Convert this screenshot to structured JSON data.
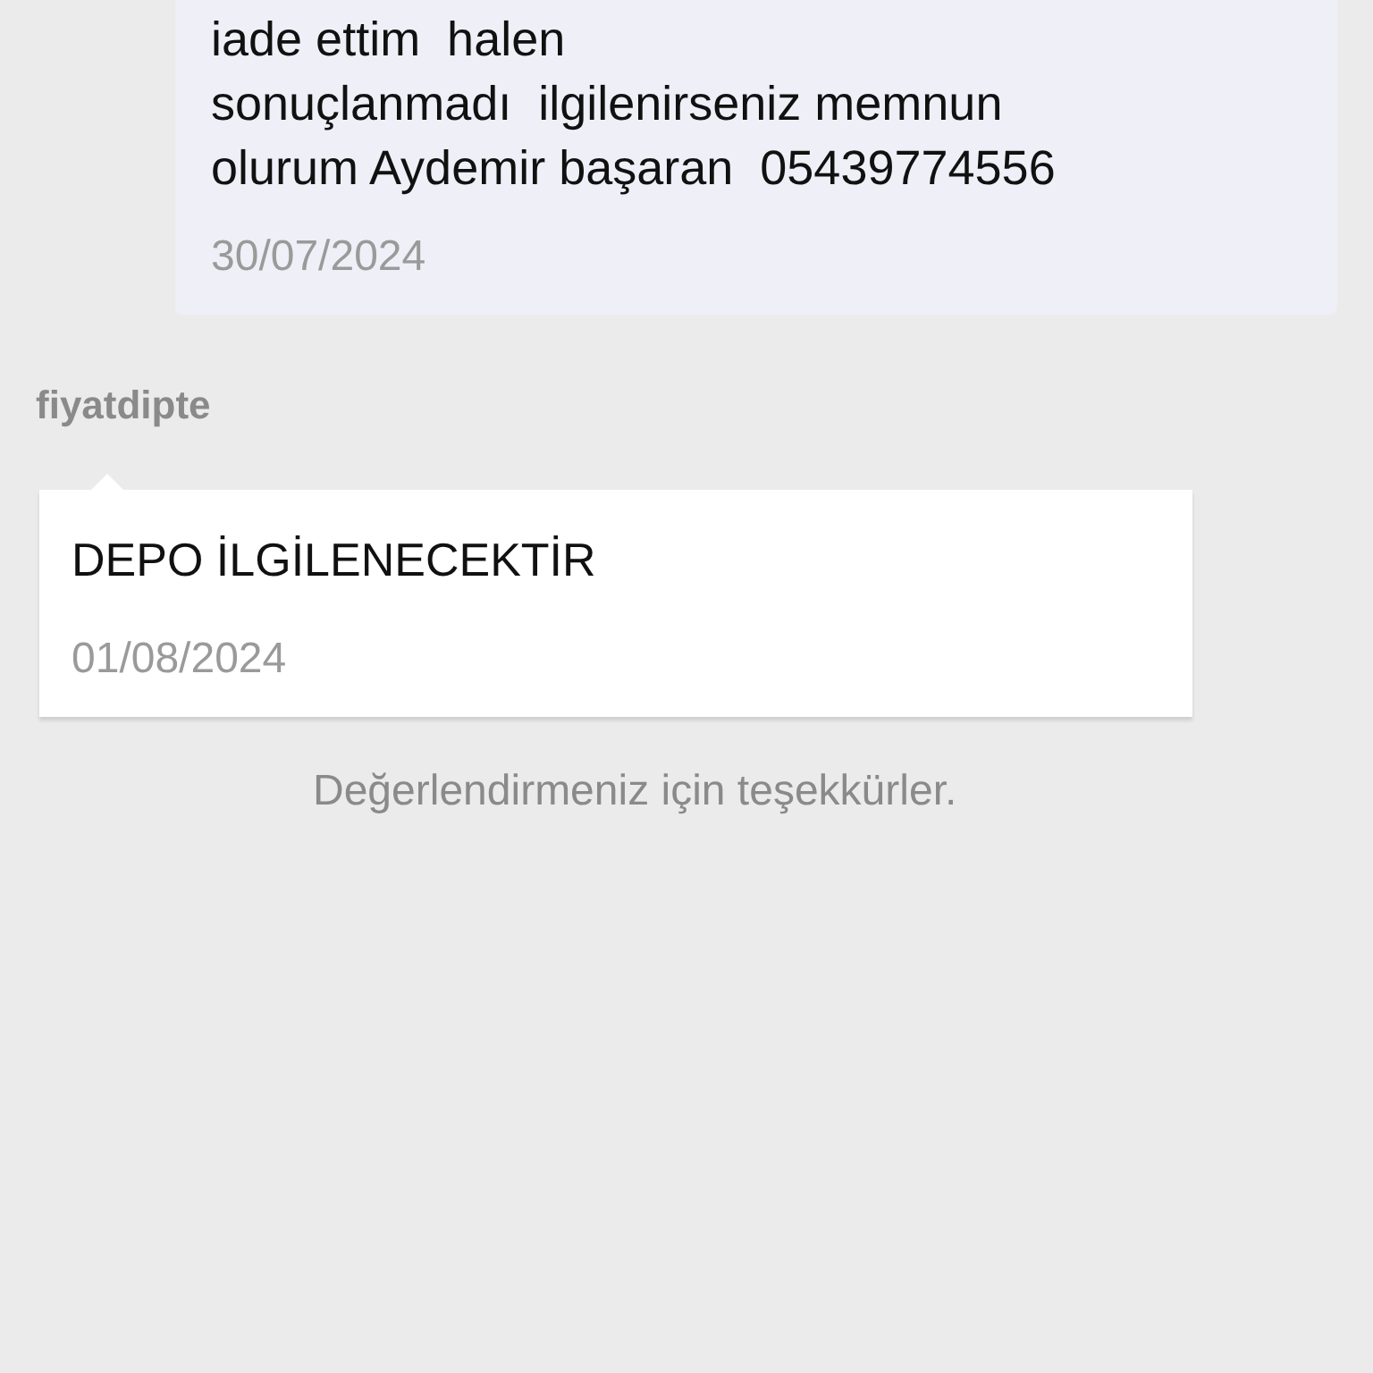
{
  "customer_message": {
    "text": "iade ettim  halen\nsonuçlanmadı  ilgilenirseniz memnun\nolurum Aydemir başaran  05439774556",
    "date": "30/07/2024"
  },
  "reply": {
    "author": "fiyatdipte",
    "text": "DEPO İLGİLENECEKTİR",
    "date": "01/08/2024"
  },
  "footer_note": "Değerlendirmeniz için teşekkürler."
}
